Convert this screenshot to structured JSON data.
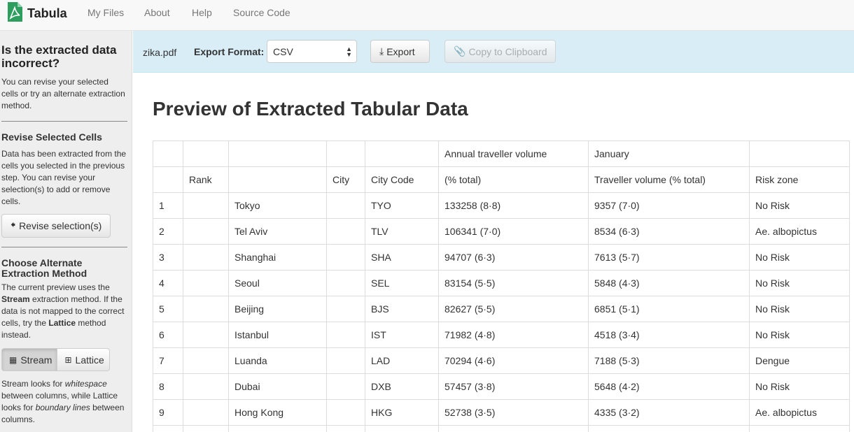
{
  "nav": {
    "brand": "Tabula",
    "links": [
      "My Files",
      "About",
      "Help",
      "Source Code"
    ]
  },
  "sidebar": {
    "title": "Is the extracted data incorrect?",
    "intro": "You can revise your selected cells or try an alternate extraction method.",
    "revise_heading": "Revise Selected Cells",
    "revise_text": "Data has been extracted from the cells you selected in the previous step. You can revise your selection(s) to add or remove cells.",
    "revise_button": "Revise selection(s)",
    "method_heading": "Choose Alternate Extraction Method",
    "method_text_1": "The current preview uses the ",
    "method_bold_1": "Stream",
    "method_text_2": " extraction method. If the data is not mapped to the correct cells, try the ",
    "method_bold_2": "Lattice",
    "method_text_3": " method instead.",
    "stream_button": "Stream",
    "lattice_button": "Lattice",
    "footer_1": "Stream looks for ",
    "footer_em_1": "whitespace",
    "footer_2": " between columns, while Lattice looks for ",
    "footer_em_2": "boundary lines",
    "footer_3": " between columns."
  },
  "toolbar": {
    "filename": "zika.pdf",
    "export_format_label": "Export Format:",
    "export_format_value": "CSV",
    "export_button": "Export",
    "copy_button": "Copy to Clipboard"
  },
  "main": {
    "title": "Preview of Extracted Tabular Data"
  },
  "table": {
    "header_rows": [
      [
        "",
        "",
        "",
        "",
        "",
        "Annual traveller volume",
        "January",
        ""
      ],
      [
        "",
        "Rank",
        "",
        "City",
        "City Code",
        "(% total)",
        "Traveller volume (% total)",
        "Risk zone"
      ]
    ],
    "rows": [
      [
        "1",
        "",
        "Tokyo",
        "",
        "TYO",
        "133258 (8·8)",
        "9357 (7·0)",
        "No Risk"
      ],
      [
        "2",
        "",
        "Tel Aviv",
        "",
        "TLV",
        "106341 (7·0)",
        "8534 (6·3)",
        "Ae. albopictus"
      ],
      [
        "3",
        "",
        "Shanghai",
        "",
        "SHA",
        "94707 (6·3)",
        "7613 (5·7)",
        "No Risk"
      ],
      [
        "4",
        "",
        "Seoul",
        "",
        "SEL",
        "83154 (5·5)",
        "5848 (4·3)",
        "No Risk"
      ],
      [
        "5",
        "",
        "Beijing",
        "",
        "BJS",
        "82627 (5·5)",
        "6851 (5·1)",
        "No Risk"
      ],
      [
        "6",
        "",
        "Istanbul",
        "",
        "IST",
        "71982 (4·8)",
        "4518 (3·4)",
        "No Risk"
      ],
      [
        "7",
        "",
        "Luanda",
        "",
        "LAD",
        "70294 (4·6)",
        "7188 (5·3)",
        "Dengue"
      ],
      [
        "8",
        "",
        "Dubai",
        "",
        "DXB",
        "57457 (3·8)",
        "5648 (4·2)",
        "No Risk"
      ],
      [
        "9",
        "",
        "Hong Kong",
        "",
        "HKG",
        "52738 (3·5)",
        "4335 (3·2)",
        "Ae. albopictus"
      ],
      [
        "",
        "",
        "",
        "",
        "",
        "",
        "",
        ""
      ]
    ]
  }
}
